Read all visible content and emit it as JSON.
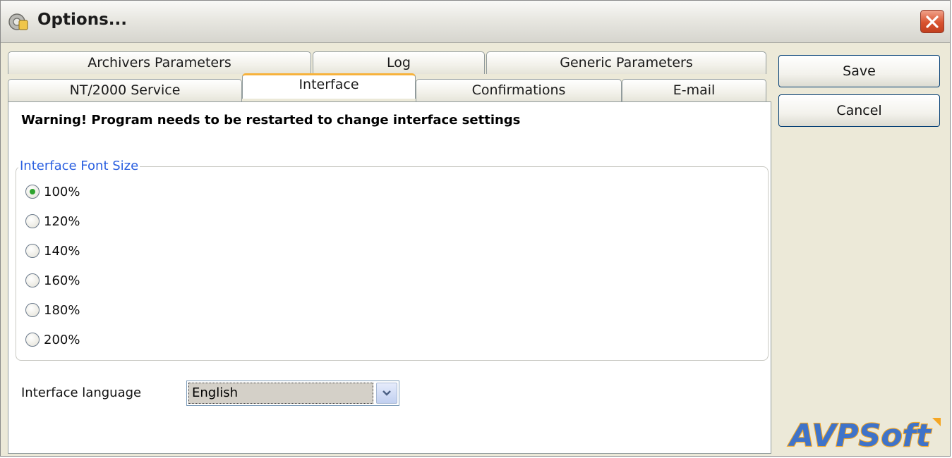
{
  "window": {
    "title": "Options..."
  },
  "tabs": {
    "row1": [
      "Archivers Parameters",
      "Log",
      "Generic Parameters"
    ],
    "row2": [
      "NT/2000 Service",
      "Interface",
      "Confirmations",
      "E-mail"
    ],
    "active": "Interface"
  },
  "interface": {
    "warning": "Warning! Program needs to be restarted to change interface settings",
    "font_group_label": "Interface Font Size",
    "font_sizes": [
      "100%",
      "120%",
      "140%",
      "160%",
      "180%",
      "200%"
    ],
    "selected_font_size": "100%",
    "language_label": "Interface language",
    "language_value": "English"
  },
  "buttons": {
    "save": "Save",
    "cancel": "Cancel"
  },
  "logo": {
    "text": "AVPSoft"
  },
  "colors": {
    "accent_tab": "#f7b23b",
    "group_legend": "#2a5fe0",
    "close_button": "#d9532f",
    "logo_blue": "#3f73c9",
    "logo_orange": "#f5a623"
  }
}
